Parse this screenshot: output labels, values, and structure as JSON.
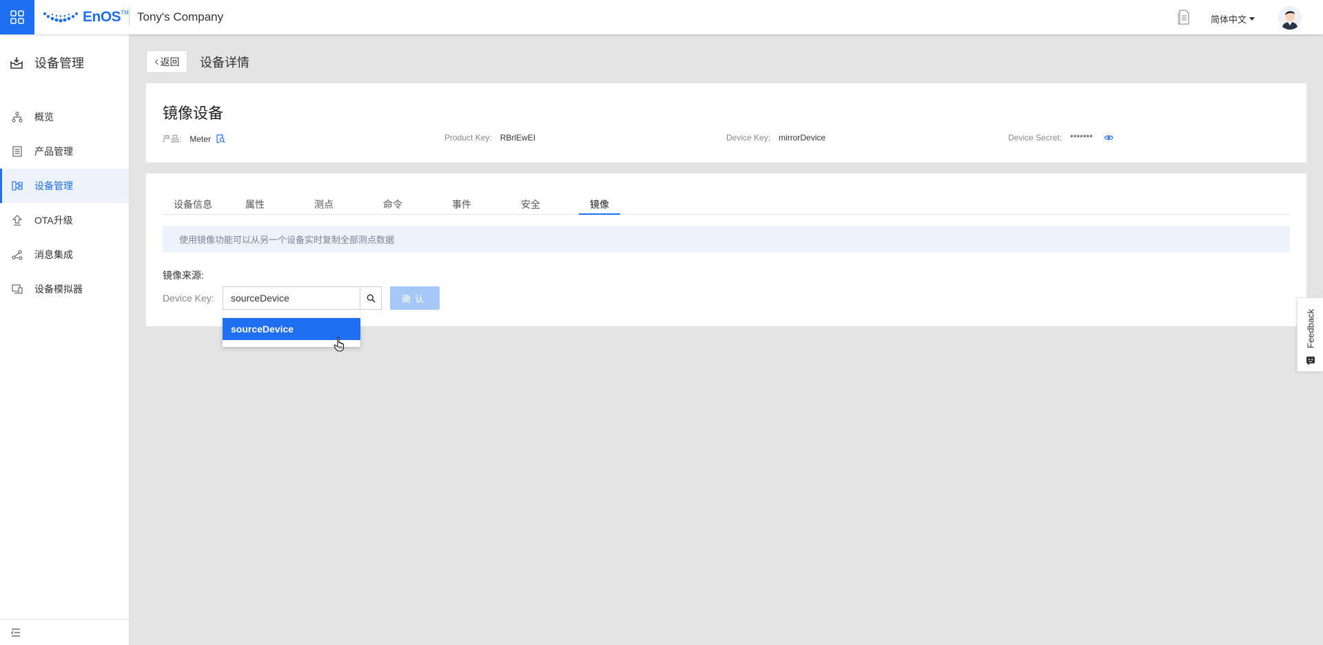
{
  "topbar": {
    "logo_text": "EnOS",
    "logo_sup": "TM",
    "company": "Tony's Company",
    "language": "简体中文"
  },
  "sidebar": {
    "title": "设备管理",
    "items": [
      {
        "label": "概览",
        "icon": "hierarchy-icon",
        "active": false
      },
      {
        "label": "产品管理",
        "icon": "list-icon",
        "active": false
      },
      {
        "label": "设备管理",
        "icon": "device-icon",
        "active": true
      },
      {
        "label": "OTA升级",
        "icon": "upload-icon",
        "active": false
      },
      {
        "label": "消息集成",
        "icon": "share-icon",
        "active": false
      },
      {
        "label": "设备模拟器",
        "icon": "simulator-icon",
        "active": false
      }
    ]
  },
  "header": {
    "back_label": "返回",
    "title": "设备详情"
  },
  "device": {
    "name": "镜像设备",
    "product_label": "产品:",
    "product_value": "Meter",
    "product_key_label": "Product Key:",
    "product_key_value": "RBrlEwEI",
    "device_key_label": "Device Key:",
    "device_key_value": "mirrorDevice",
    "device_secret_label": "Device Secret:",
    "device_secret_value": "*******"
  },
  "tabs": [
    {
      "label": "设备信息",
      "active": false
    },
    {
      "label": "属性",
      "active": false
    },
    {
      "label": "测点",
      "active": false
    },
    {
      "label": "命令",
      "active": false
    },
    {
      "label": "事件",
      "active": false
    },
    {
      "label": "安全",
      "active": false
    },
    {
      "label": "镜像",
      "active": true
    }
  ],
  "mirror": {
    "notice": "使用镜像功能可以从另一个设备实时复制全部测点数据",
    "source_label": "镜像来源:",
    "device_key_label": "Device Key:",
    "search_value": "sourceDevice",
    "confirm_label": "确认",
    "dropdown_options": [
      "sourceDevice"
    ]
  },
  "feedback": {
    "label": "Feedback"
  },
  "colors": {
    "primary": "#1f6ff3",
    "disabled_button": "#a5c8f8",
    "notice_bg": "#eef3fb"
  }
}
